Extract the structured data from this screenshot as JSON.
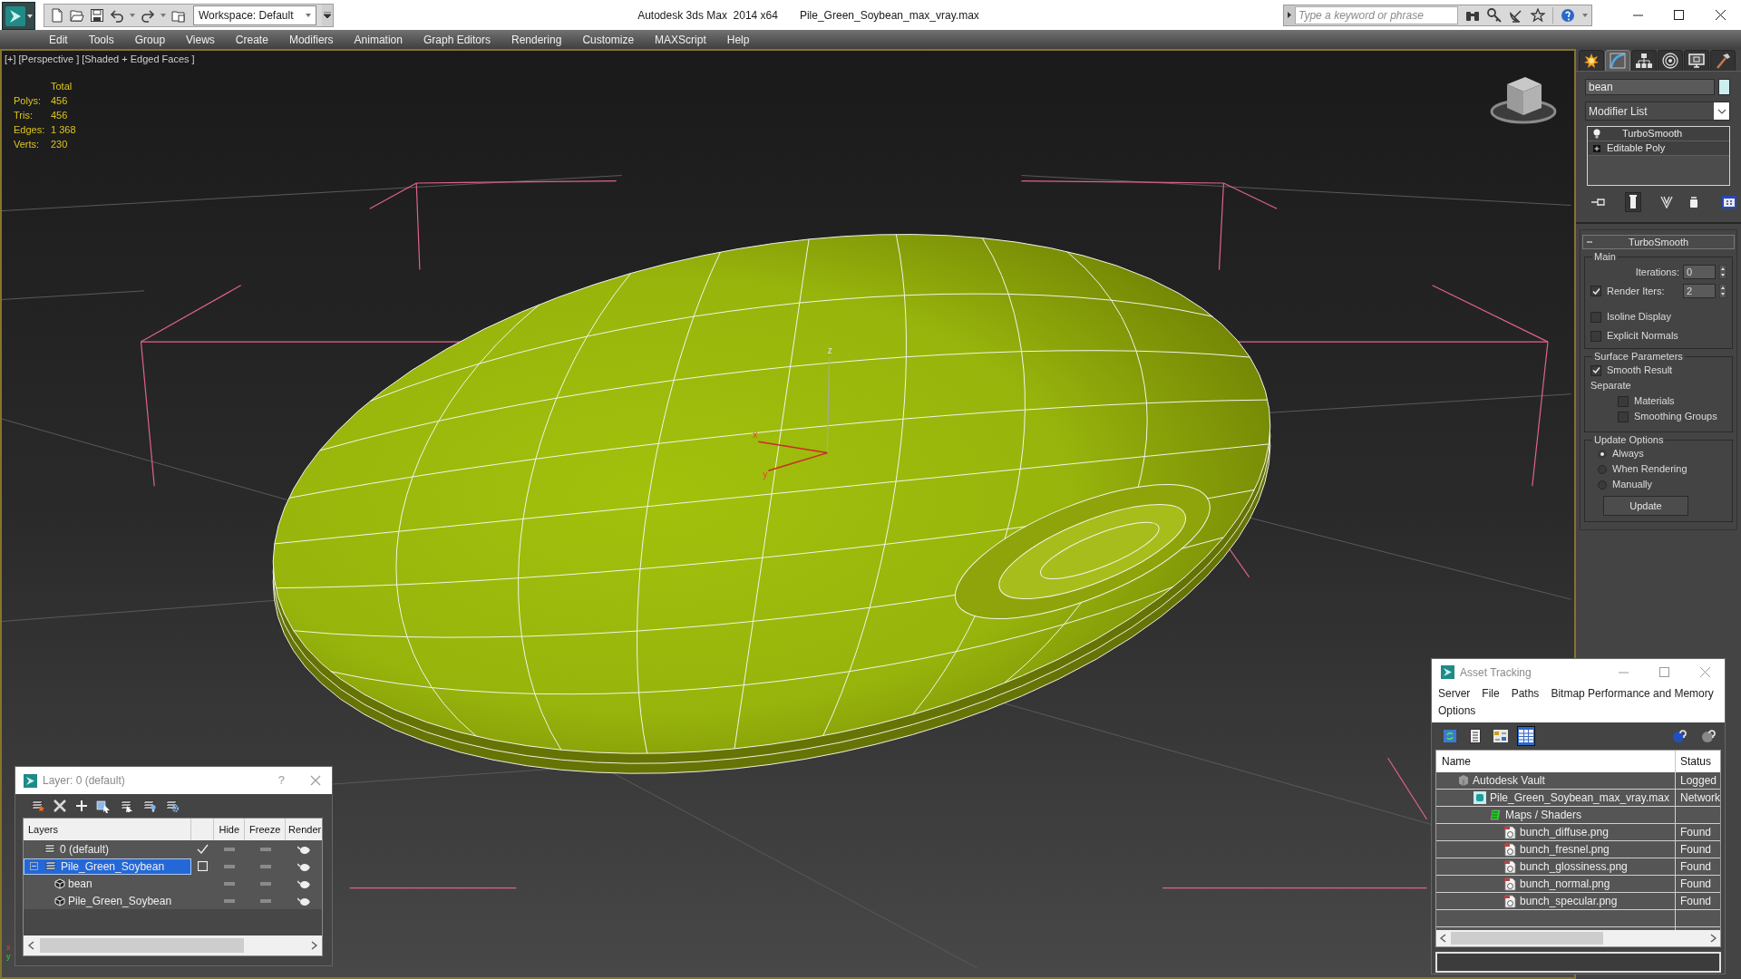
{
  "title_bar": {
    "workspace": "Workspace: Default",
    "app_title": "Autodesk 3ds Max  2014 x64",
    "file_name": "Pile_Green_Soybean_max_vray.max",
    "search": {
      "placeholder": "Type a keyword or phrase"
    }
  },
  "menu_bar": [
    "Edit",
    "Tools",
    "Group",
    "Views",
    "Create",
    "Modifiers",
    "Animation",
    "Graph Editors",
    "Rendering",
    "Customize",
    "MAXScript",
    "Help"
  ],
  "viewport": {
    "labels": [
      "[+]",
      "[Perspective ]",
      "[Shaded + Edged Faces ]"
    ],
    "stats": {
      "heading": "Total",
      "rows": [
        {
          "label": "Polys:",
          "value": "456"
        },
        {
          "label": "Tris:",
          "value": "456"
        },
        {
          "label": "Edges:",
          "value": "1 368"
        },
        {
          "label": "Verts:",
          "value": "230"
        }
      ]
    },
    "gizmo_axes": [
      "z",
      "x",
      "y"
    ],
    "world_axes": [
      "x",
      "y"
    ]
  },
  "command_panel": {
    "tabs": [
      {
        "kind": "create",
        "selected": false
      },
      {
        "kind": "modify",
        "selected": true
      },
      {
        "kind": "hierarchy",
        "selected": false
      },
      {
        "kind": "motion",
        "selected": false
      },
      {
        "kind": "display",
        "selected": false
      },
      {
        "kind": "utilities",
        "selected": false
      }
    ],
    "object_name": "bean",
    "modifier_list": "Modifier List",
    "stack": [
      {
        "kind": "modifier",
        "label": "TurboSmooth",
        "on": true
      },
      {
        "kind": "base",
        "label": "Editable Poly",
        "expanded": false
      }
    ],
    "stack_tools": [
      {
        "kind": "pin",
        "selected": false
      },
      {
        "kind": "end_result",
        "selected": true
      },
      {
        "kind": "make_unique",
        "selected": false
      },
      {
        "kind": "remove",
        "selected": false
      },
      {
        "kind": "configure",
        "selected": false
      }
    ],
    "rollout": {
      "title": "TurboSmooth",
      "expanded": true,
      "main": {
        "title": "Main",
        "iterations": {
          "label": "Iterations:",
          "value": "0"
        },
        "render_iters": {
          "label": "Render Iters:",
          "checked": true,
          "value": "2"
        },
        "checks": [
          {
            "label": "Isoline Display",
            "checked": false
          },
          {
            "label": "Explicit Normals",
            "checked": false
          }
        ]
      },
      "surface": {
        "title": "Surface Parameters",
        "smooth_result": {
          "label": "Smooth Result",
          "checked": true
        },
        "separate": {
          "label": "Separate",
          "checks": [
            {
              "label": "Materials",
              "checked": false
            },
            {
              "label": "Smoothing Groups",
              "checked": false
            }
          ]
        }
      },
      "update": {
        "title": "Update Options",
        "radios": [
          {
            "label": "Always",
            "selected": true
          },
          {
            "label": "When Rendering",
            "selected": false
          },
          {
            "label": "Manually",
            "selected": false
          }
        ],
        "button": "Update"
      }
    }
  },
  "layer_dialog": {
    "title": "Layer: 0 (default)",
    "help": "?",
    "columns": [
      "Layers",
      "Hide",
      "Freeze",
      "Render"
    ],
    "layers": [
      {
        "name": "0 (default)",
        "current": true,
        "selected": false,
        "hidden": false,
        "frozen": false,
        "renderable": true
      },
      {
        "name": "Pile_Green_Soybean",
        "current": false,
        "selected": true,
        "expanded": true,
        "hidden": false,
        "frozen": false,
        "renderable": true,
        "children": [
          {
            "name": "bean",
            "hidden": false,
            "frozen": false,
            "renderable": true
          },
          {
            "name": "Pile_Green_Soybean",
            "hidden": false,
            "frozen": false,
            "renderable": true
          }
        ]
      }
    ]
  },
  "asset_tracking": {
    "title": "Asset Tracking",
    "menu": [
      "Server",
      "File",
      "Paths",
      "Bitmap Performance and Memory",
      "Options"
    ],
    "toolbar": [
      {
        "kind": "refresh",
        "selected": false
      },
      {
        "kind": "list",
        "selected": false
      },
      {
        "kind": "thumbnail",
        "selected": false
      },
      {
        "kind": "table",
        "selected": true
      }
    ],
    "columns": [
      "Name",
      "Status"
    ],
    "tree": [
      {
        "kind": "vault",
        "name": "Autodesk Vault",
        "status": "Logged",
        "children": [
          {
            "kind": "scene",
            "name": "Pile_Green_Soybean_max_vray.max",
            "status": "Network",
            "children": [
              {
                "kind": "folder",
                "name": "Maps / Shaders",
                "children": [
                  {
                    "kind": "bitmap",
                    "name": "bunch_diffuse.png",
                    "status": "Found"
                  },
                  {
                    "kind": "bitmap",
                    "name": "bunch_fresnel.png",
                    "status": "Found"
                  },
                  {
                    "kind": "bitmap",
                    "name": "bunch_glossiness.png",
                    "status": "Found"
                  },
                  {
                    "kind": "bitmap",
                    "name": "bunch_normal.png",
                    "status": "Found"
                  },
                  {
                    "kind": "bitmap",
                    "name": "bunch_specular.png",
                    "status": "Found"
                  }
                ]
              }
            ]
          }
        ]
      }
    ]
  }
}
